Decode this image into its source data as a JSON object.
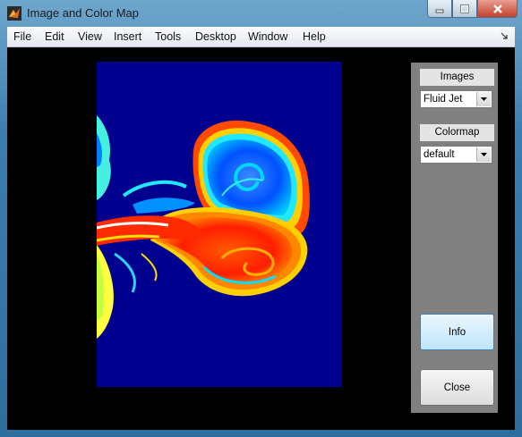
{
  "window": {
    "title": "Image and Color Map",
    "icons": {
      "app": "matlab-icon",
      "minimize": "minimize-icon",
      "maximize": "maximize-icon",
      "close": "close-icon"
    }
  },
  "menubar": {
    "items": [
      "File",
      "Edit",
      "View",
      "Insert",
      "Tools",
      "Desktop",
      "Window",
      "Help"
    ],
    "dock_icon": "dock-arrow-icon"
  },
  "image": {
    "content": "fluid-jet-colormap-image",
    "colors": {
      "background": "#00008f",
      "cool": "#0064ff",
      "cyan": "#3cf0ff",
      "warm": "#ff2a00",
      "hot": "#ff6a00",
      "yellow": "#ffff00"
    }
  },
  "panel": {
    "images_title": "Images",
    "images_value": "Fluid Jet",
    "colormap_title": "Colormap",
    "colormap_value": "default",
    "info_label": "Info",
    "close_label": "Close"
  }
}
